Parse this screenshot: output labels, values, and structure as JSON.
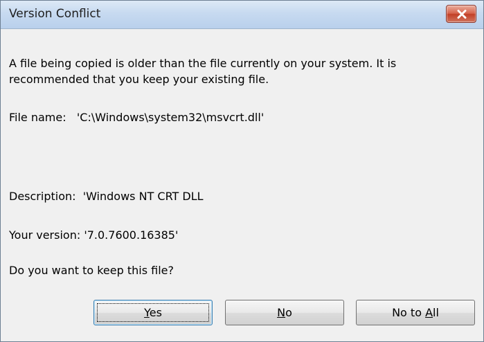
{
  "window": {
    "title": "Version Conflict"
  },
  "message": {
    "intro": "A file being copied is older than the file currently on your system.  It is recommended that you keep your existing file.",
    "file_name_label": "File name:",
    "file_name_value": "'C:\\Windows\\system32\\msvcrt.dll'",
    "description_label": "Description:",
    "description_value": "'Windows NT CRT DLL",
    "version_label": "Your version:",
    "version_value": "'7.0.7600.16385'",
    "question": "Do you want to keep this file?"
  },
  "buttons": {
    "yes": {
      "mnemonic": "Y",
      "rest": "es"
    },
    "no": {
      "mnemonic": "N",
      "rest": "o"
    },
    "no_to_all": {
      "prefix": "No to ",
      "mnemonic": "A",
      "rest": "ll"
    }
  },
  "icons": {
    "close": "close-x-icon"
  },
  "colors": {
    "close_button": "#c8442c",
    "titlebar": "#c7daf0",
    "dialog_background": "#f0f0f0"
  }
}
